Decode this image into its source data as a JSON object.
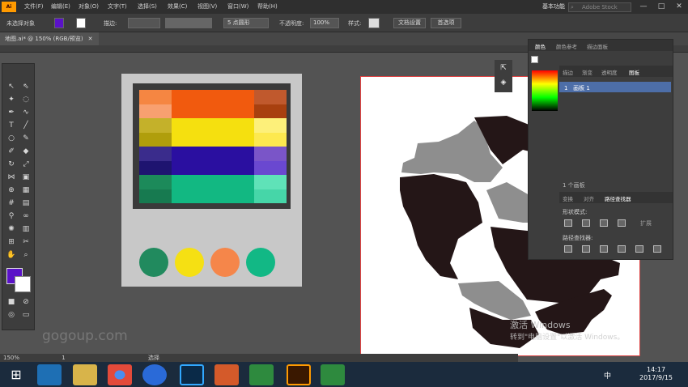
{
  "app": {
    "logo": "Ai"
  },
  "menu": [
    "文件(F)",
    "编辑(E)",
    "对象(O)",
    "文字(T)",
    "选择(S)",
    "效果(C)",
    "视图(V)",
    "窗口(W)",
    "帮助(H)"
  ],
  "menu_extra": "Ai",
  "workspace": "基本功能",
  "search_placeholder": "Adobe Stock",
  "window_buttons": [
    "—",
    "□",
    "✕"
  ],
  "control": {
    "no_selection": "未选择对象",
    "stroke_label": "描边:",
    "brush": "5 点圆形",
    "opacity_label": "不透明度:",
    "opacity_value": "100%",
    "style_label": "样式:",
    "doc_setup": "文档设置",
    "preferences": "首选项"
  },
  "doc_tab": "地图.ai* @ 150% (RGB/预览)",
  "colors": {
    "fill": "#5a12c8",
    "accent": "#ff9a00",
    "selection": "#4d6ea8"
  },
  "palette": {
    "rows": [
      [
        "#f58642",
        "#f15a0e",
        "#c0592d"
      ],
      [
        "#f8a070",
        "#f15a0e",
        "#a8400f"
      ],
      [
        "#c4b12a",
        "#f5e00f",
        "#fdf07a"
      ],
      [
        "#b09e0c",
        "#f5e00f",
        "#fde94f"
      ],
      [
        "#3a2c8c",
        "#2a0fa0",
        "#7a55c8"
      ],
      [
        "#1e1470",
        "#2a0fa0",
        "#6a48d0"
      ],
      [
        "#1c8a5a",
        "#12b882",
        "#5fe2b8"
      ],
      [
        "#177a50",
        "#12b882",
        "#46d6a8"
      ]
    ]
  },
  "dots": [
    "#218a5e",
    "#f5e013",
    "#f5864a",
    "#12b885"
  ],
  "panel": {
    "tabs_top": [
      "颜色",
      "颜色参考",
      "描边面板"
    ],
    "tabs_mid": [
      "描边",
      "渐变",
      "透明度",
      "图板"
    ],
    "layer_num": "1",
    "layer_name": "画板 1",
    "layer_count": "1 个画板",
    "tabs_bottom": [
      "变换",
      "对齐",
      "路径查找器"
    ],
    "shape_modes": "形状模式:",
    "pathfinder": "路径查找器:",
    "expand": "扩展"
  },
  "status": {
    "zoom": "150%",
    "page": "1",
    "tool": "选择"
  },
  "watermark": "gogoup.com",
  "activate": {
    "line1": "激活 Windows",
    "line2": "转到\"电脑设置\"以激活 Windows。"
  },
  "taskbar": {
    "ime": "中",
    "time": "14:17",
    "date": "2017/9/15"
  }
}
